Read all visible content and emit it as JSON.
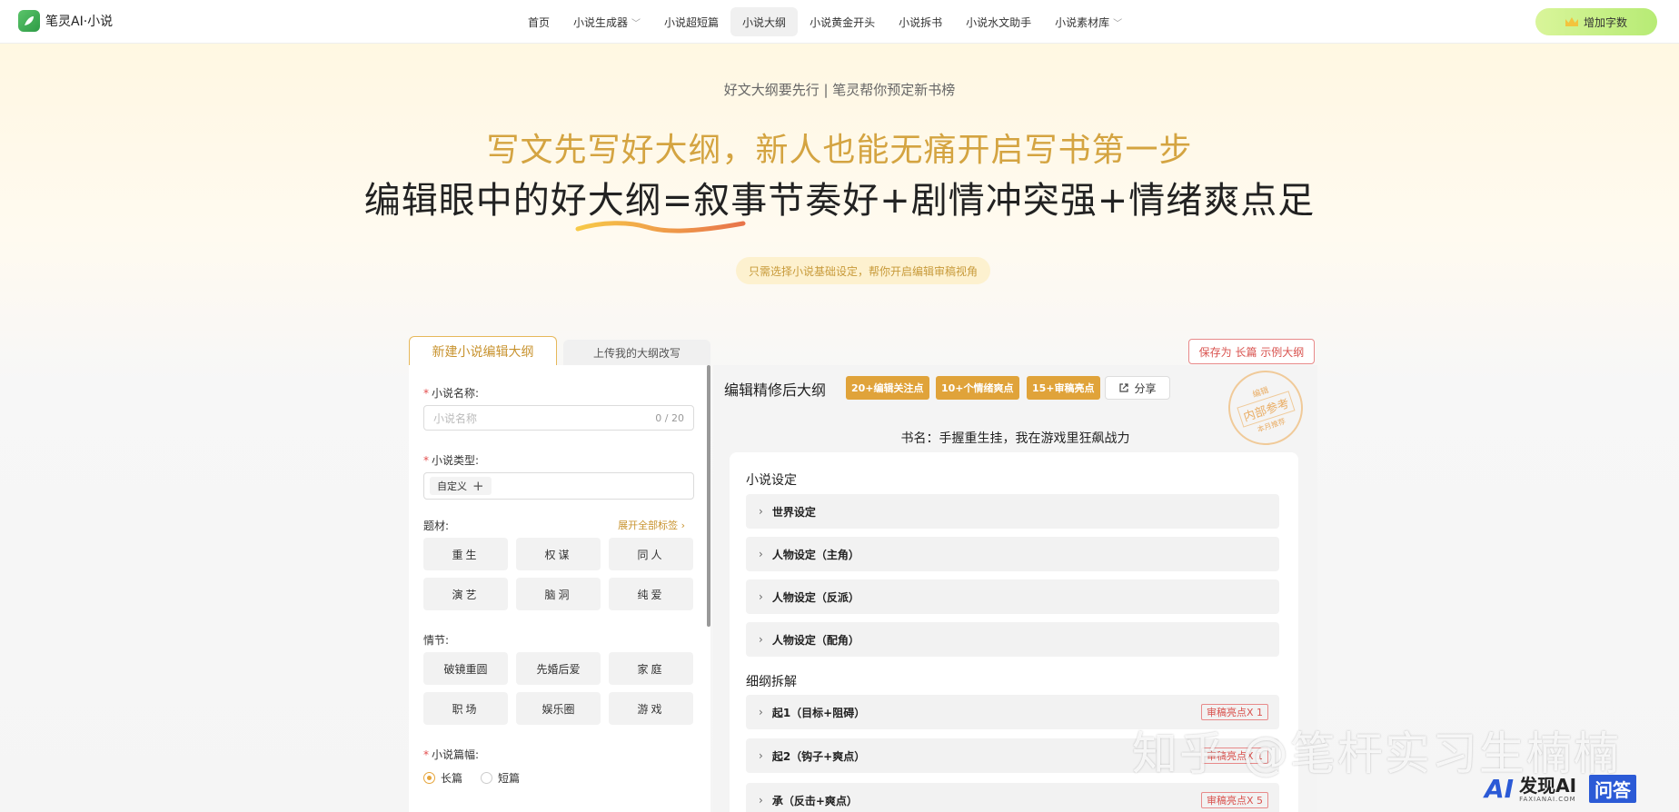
{
  "header": {
    "logo_text": "笔灵AI·小说",
    "nav": [
      {
        "label": "首页",
        "dropdown": false,
        "active": false
      },
      {
        "label": "小说生成器",
        "dropdown": true,
        "active": false
      },
      {
        "label": "小说超短篇",
        "dropdown": false,
        "active": false
      },
      {
        "label": "小说大纲",
        "dropdown": false,
        "active": true
      },
      {
        "label": "小说黄金开头",
        "dropdown": false,
        "active": false
      },
      {
        "label": "小说拆书",
        "dropdown": false,
        "active": false
      },
      {
        "label": "小说水文助手",
        "dropdown": false,
        "active": false
      },
      {
        "label": "小说素材库",
        "dropdown": true,
        "active": false
      }
    ],
    "add_words_label": "增加字数"
  },
  "hero": {
    "subtitle": "好文大纲要先行 | 笔灵帮你预定新书榜",
    "line1": "写文先写好大纲，新人也能无痛开启写书第一步",
    "line2": "编辑眼中的好大纲=叙事节奏好+剧情冲突强+情绪爽点足",
    "pill": "只需选择小说基础设定，帮你开启编辑审稿视角"
  },
  "tabs": {
    "new_outline": "新建小说编辑大纲",
    "upload_outline": "上传我的大纲改写",
    "save_sample": "保存为 长篇 示例大纲"
  },
  "form": {
    "name_label": "小说名称:",
    "name_placeholder": "小说名称",
    "name_count": "0 / 20",
    "type_label": "小说类型:",
    "type_chip": "自定义",
    "theme_label": "题材:",
    "expand_all": "展开全部标签",
    "theme_tags": [
      "重生",
      "权谋",
      "同人",
      "演艺",
      "脑洞",
      "纯爱"
    ],
    "plot_label": "情节:",
    "plot_tags": [
      "破镜重圆",
      "先婚后爱",
      "家庭",
      "职场",
      "娱乐圈",
      "游戏"
    ],
    "length_label": "小说篇幅:",
    "length_options": [
      {
        "label": "长篇",
        "selected": true
      },
      {
        "label": "短篇",
        "selected": false
      }
    ]
  },
  "preview": {
    "title": "编辑精修后大纲",
    "badges": [
      "20+编辑关注点",
      "10+个情绪爽点",
      "15+审稿亮点"
    ],
    "share_label": "分享",
    "stamp": {
      "top": "编辑",
      "main": "内部参考",
      "bottom": "本月推荐"
    },
    "book_name": "书名：手握重生挂，我在游戏里狂飙战力",
    "setting_title": "小说设定",
    "setting_rows": [
      "世界设定",
      "人物设定（主角）",
      "人物设定（反派）",
      "人物设定（配角）"
    ],
    "outline_title": "细纲拆解",
    "outline_rows": [
      {
        "label": "起1（目标+阻碍）",
        "badge": "审稿亮点X 1"
      },
      {
        "label": "起2（钩子+爽点）",
        "badge": "审稿亮点X 1"
      },
      {
        "label": "承（反击+爽点）",
        "badge": "审稿亮点X 5"
      }
    ]
  },
  "watermarks": {
    "zhihu": "知乎 @笔杆实习生楠楠",
    "fx_logo": "AI",
    "fx_main": "发现AI",
    "fx_url": "FAXIANAI.COM",
    "fx_qa": "问答"
  },
  "colors": {
    "accent": "#e0a33a",
    "gold_text": "#d4a441",
    "danger": "#d9534f",
    "add_button": "#b7eb75"
  }
}
